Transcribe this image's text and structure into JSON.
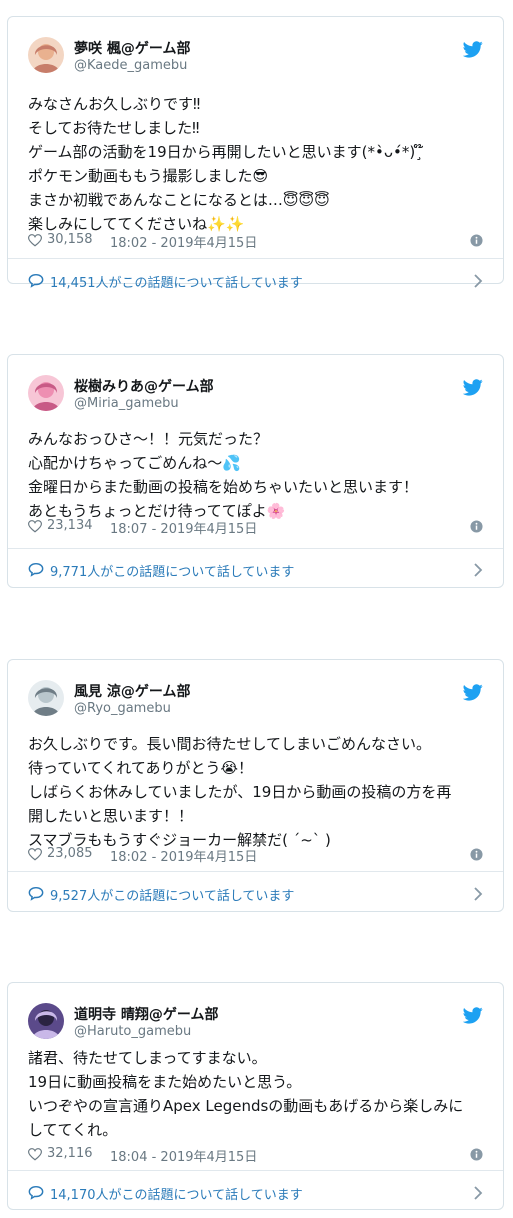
{
  "tweets": [
    {
      "name": "夢咲 楓@ゲーム部",
      "handle": "@Kaede_gamebu",
      "lines": [
        "みなさんお久しぶりです‼",
        "そしてお待たせしました‼",
        "ゲーム部の活動を19日から再開したいと思います(*•̀ᴗ•́*)¸໊",
        "ポケモン動画ももう撮影しました😎",
        "まさか初戦であんなことになるとは…😇😇😇",
        "楽しみにしててくださいね✨✨"
      ],
      "likes": "30,158",
      "date": "18:02 - 2019年4月15日",
      "talk": "14,451人がこの話題について話しています",
      "avatar_colors": [
        "#f3d6c3",
        "#e9b18f",
        "#c77d6a"
      ]
    },
    {
      "name": "桜樹みりあ@ゲーム部",
      "handle": "@Miria_gamebu",
      "lines": [
        "みんなおっひさ～！！元気だった？",
        "心配かけちゃってごめんね～💦",
        "金曜日からまた動画の投稿を始めちゃいたいと思います！",
        "あともうちょっとだけ待っててぽよ🌸"
      ],
      "likes": "23,134",
      "date": "18:07 - 2019年4月15日",
      "talk": "9,771人がこの話題について話しています",
      "avatar_colors": [
        "#f7c6d6",
        "#ee8fb2",
        "#c85a86"
      ]
    },
    {
      "name": "風見 涼@ゲーム部",
      "handle": "@Ryo_gamebu",
      "lines": [
        "お久しぶりです。長い間お待たせしてしまいごめんなさい。",
        "待っていてくれてありがとう😭！",
        "しばらくお休みしていましたが、19日から動画の投稿の方を再",
        "開したいと思います！！",
        "スマブラももうすぐジョーカー解禁だ( ´~` )"
      ],
      "likes": "23,085",
      "date": "18:02 - 2019年4月15日",
      "talk": "9,527人がこの話題について話しています",
      "avatar_colors": [
        "#e6ecef",
        "#b9c6cc",
        "#6f7d86"
      ]
    },
    {
      "name": "道明寺 晴翔@ゲーム部",
      "handle": "@Haruto_gamebu",
      "lines": [
        "諸君、待たせてしまってすまない。",
        "19日に動画投稿をまた始めたいと思う。",
        "いつぞやの宣言通りApex Legendsの動画もあげるから楽しみに",
        "しててくれ。"
      ],
      "likes": "32,116",
      "date": "18:04 - 2019年4月15日",
      "talk": "14,170人がこの話題について話しています",
      "avatar_colors": [
        "#5b4a8a",
        "#2a2342",
        "#c9b8e8"
      ]
    }
  ],
  "colors": {
    "brand": "#1da1f2",
    "link": "#2b7bb9",
    "muted": "#697882"
  }
}
